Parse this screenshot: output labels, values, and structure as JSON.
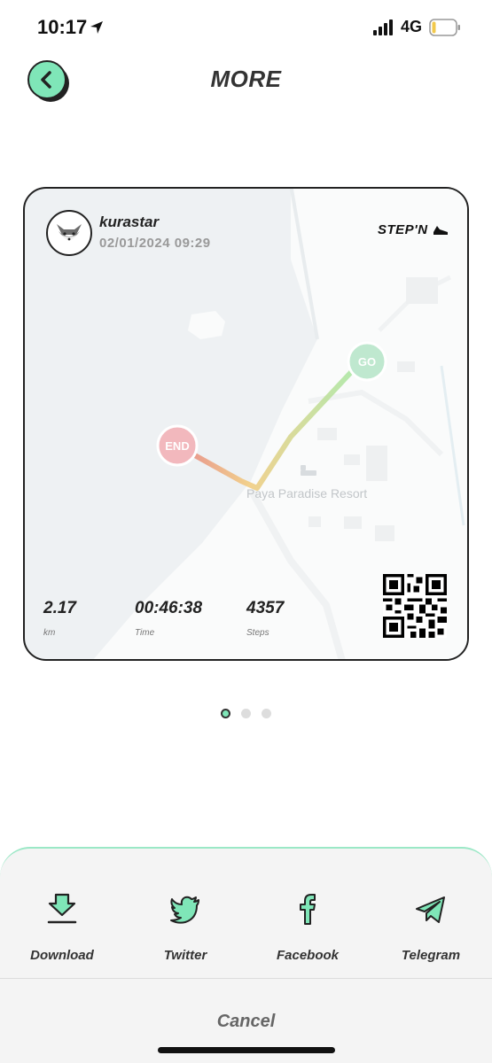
{
  "status_bar": {
    "time": "10:17",
    "network": "4G"
  },
  "header": {
    "title": "MORE"
  },
  "card": {
    "username": "kurastar",
    "datetime": "02/01/2024 09:29",
    "brand": "STEP'N",
    "map": {
      "place_label": "Paya Paradise Resort",
      "start_marker": "GO",
      "end_marker": "END"
    },
    "stats": [
      {
        "value": "2.17",
        "unit": "km"
      },
      {
        "value": "00:46:38",
        "unit": "Time"
      },
      {
        "value": "4357",
        "unit": "Steps"
      }
    ]
  },
  "pager": {
    "count": 3,
    "active_index": 0
  },
  "share_sheet": {
    "options": [
      {
        "label": "Download",
        "icon": "download-icon"
      },
      {
        "label": "Twitter",
        "icon": "twitter-icon"
      },
      {
        "label": "Facebook",
        "icon": "facebook-icon"
      },
      {
        "label": "Telegram",
        "icon": "telegram-icon"
      }
    ],
    "cancel_label": "Cancel"
  },
  "colors": {
    "accent": "#7fe6b8",
    "end_marker": "#f2b8bd",
    "go_marker": "#bfe8cf",
    "card_border": "#222222"
  }
}
